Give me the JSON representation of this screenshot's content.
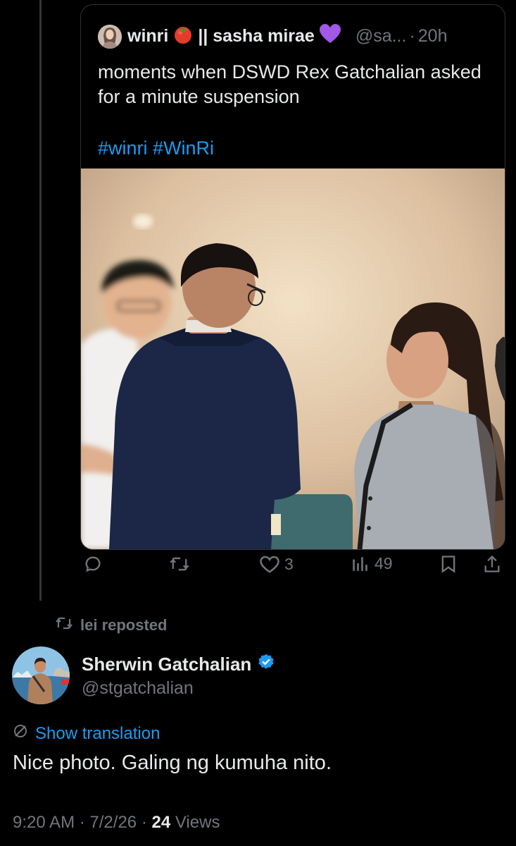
{
  "quoted": {
    "display_name": "winri",
    "name_emoji": "🍅",
    "display_name_2": "|| sasha mirae",
    "name_emoji_2": "💜",
    "handle": "@sa...",
    "separator": "·",
    "time": "20h",
    "text": "moments when DSWD Rex Gatchalian asked for a minute suspension",
    "hashtags": [
      "#winri",
      "#WinRi"
    ],
    "image_icon": "photo-of-people-in-office"
  },
  "actions": {
    "reply_icon": "reply-icon",
    "repost_icon": "repost-icon",
    "like_icon": "heart-icon",
    "like_count": "3",
    "views_icon": "views-icon",
    "views_count": "49",
    "bookmark_icon": "bookmark-icon",
    "share_icon": "share-icon"
  },
  "repost": {
    "icon": "repost-icon",
    "label": "lei reposted"
  },
  "post": {
    "display_name": "Sherwin Gatchalian",
    "verified_icon": "verified-badge-icon",
    "handle": "@stgatchalian",
    "translate_label": "Show translation",
    "text": "Nice photo. Galing ng kumuha nito.",
    "time": "9:20 AM",
    "date": "7/2/26",
    "separator": "·",
    "views_count": "24",
    "views_label": "Views"
  },
  "colors": {
    "background": "#000000",
    "text_primary": "#e7e9ea",
    "text_secondary": "#71767b",
    "accent": "#1d9bf0",
    "border": "#2f3336"
  }
}
